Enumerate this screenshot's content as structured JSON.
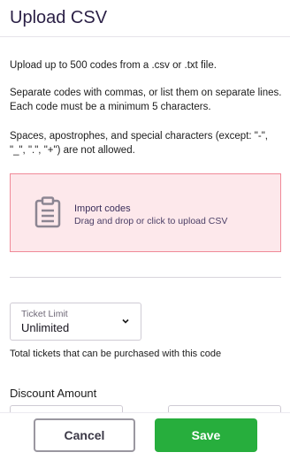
{
  "header": {
    "title": "Upload CSV"
  },
  "instructions": {
    "p1": "Upload up to 500 codes from a .csv or .txt file.",
    "p2": "Separate codes with commas, or list them on separate lines. Each code must be a minimum 5 characters.",
    "p3": "Spaces, apostrophes, and special characters (except: \"-\", \"_\", \".\", \"+\") are not allowed."
  },
  "dropzone": {
    "title": "Import codes",
    "subtitle": "Drag and drop or click to upload CSV",
    "icon": "clipboard-icon",
    "bg_color": "#fde8eb",
    "border_color": "#f08a98"
  },
  "ticket_limit": {
    "label": "Ticket Limit",
    "value": "Unlimited",
    "helper": "Total tickets that can be purchased with this code"
  },
  "discount": {
    "label": "Discount Amount"
  },
  "footer": {
    "cancel_label": "Cancel",
    "save_label": "Save",
    "save_color": "#27ae3d"
  }
}
